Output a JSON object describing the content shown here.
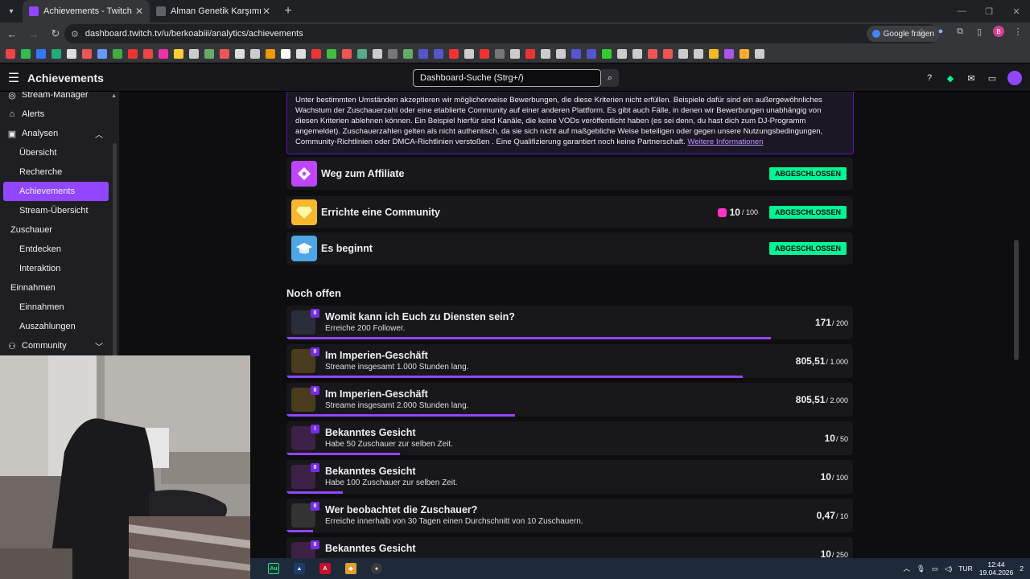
{
  "browser": {
    "tabs": [
      {
        "label": "Achievements - Twitch",
        "active": true,
        "color": "#9147ff"
      },
      {
        "label": "Alman Genetik Karşımı",
        "active": false,
        "color": "#5f6368"
      }
    ],
    "url": "dashboard.twitch.tv/u/berkoabiii/analytics/achievements",
    "google_fragen": "Google fragen",
    "profile_letter": "B"
  },
  "header": {
    "title": "Achievements",
    "search_placeholder": "Dashboard-Suche (Strg+/)"
  },
  "sidebar": {
    "items": [
      {
        "label": "Stream-Manager",
        "level": "top",
        "icon": "stream-manager-icon"
      },
      {
        "label": "Alerts",
        "level": "top",
        "icon": "alerts-icon"
      },
      {
        "label": "Analysen",
        "level": "top",
        "icon": "analytics-icon",
        "expanded": true
      },
      {
        "label": "Übersicht",
        "level": "sub"
      },
      {
        "label": "Recherche",
        "level": "sub"
      },
      {
        "label": "Achievements",
        "level": "sub",
        "active": true
      },
      {
        "label": "Stream-Übersicht",
        "level": "sub"
      },
      {
        "label": "Zuschauer",
        "level": "mid"
      },
      {
        "label": "Entdecken",
        "level": "sub"
      },
      {
        "label": "Interaktion",
        "level": "sub"
      },
      {
        "label": "Einnahmen",
        "level": "mid"
      },
      {
        "label": "Einnahmen",
        "level": "sub"
      },
      {
        "label": "Auszahlungen",
        "level": "sub"
      },
      {
        "label": "Community",
        "level": "top",
        "icon": "community-icon",
        "collapsed": true
      }
    ]
  },
  "notice": {
    "text": "Unter bestimmten Umständen akzeptieren wir möglicherweise Bewerbungen, die diese Kriterien nicht erfüllen. Beispiele dafür sind ein außergewöhnliches Wachstum der Zuschauerzahl oder eine etablierte Community auf einer anderen Plattform. Es gibt auch Fälle, in denen wir Bewerbungen unabhängig von diesen Kriterien ablehnen können. Ein Beispiel hierfür sind Kanäle, die keine VODs veröffentlicht haben (es sei denn, du hast dich zum DJ-Programm angemeldet). Zuschauerzahlen gelten als nicht authentisch, da sie sich nicht auf maßgebliche Weise beteiligen oder gegen unsere Nutzungsbedingungen, Community-Richtlinien oder DMCA-Richtlinien verstoßen . Eine Qualifizierung garantiert noch keine Partnerschaft.",
    "link": "Weitere Informationen"
  },
  "completed": [
    {
      "name": "Weg zum Affiliate",
      "status": "ABGESCHLOSSEN",
      "badge_color": "#bf45ff",
      "progress": ""
    },
    {
      "name": "Errichte eine Community",
      "status": "ABGESCHLOSSEN",
      "badge_color": "#f5b82e",
      "progress": "10",
      "progress_total": "/ 100"
    },
    {
      "name": "Es beginnt",
      "status": "ABGESCHLOSSEN",
      "badge_color": "#4fa6e6",
      "progress": ""
    }
  ],
  "open_section_title": "Noch offen",
  "open": [
    {
      "level": "II",
      "title": "Womit kann ich Euch zu Diensten sein?",
      "desc": "Erreiche 200 Follower.",
      "value": "171",
      "total": "/ 200",
      "fraction": 0.855,
      "thumb": "#2a2d3a"
    },
    {
      "level": "II",
      "title": "Im Imperien-Geschäft",
      "desc": "Streame insgesamt 1.000 Stunden lang.",
      "value": "805,51",
      "total": "/ 1.000",
      "fraction": 0.8055,
      "thumb": "#4a3c1e"
    },
    {
      "level": "II",
      "title": "Im Imperien-Geschäft",
      "desc": "Streame insgesamt 2.000 Stunden lang.",
      "value": "805,51",
      "total": "/ 2.000",
      "fraction": 0.4028,
      "thumb": "#4a3c1e"
    },
    {
      "level": "I",
      "title": "Bekanntes Gesicht",
      "desc": "Habe 50 Zuschauer zur selben Zeit.",
      "value": "10",
      "total": "/ 50",
      "fraction": 0.2,
      "thumb": "#3d2147"
    },
    {
      "level": "II",
      "title": "Bekanntes Gesicht",
      "desc": "Habe 100 Zuschauer zur selben Zeit.",
      "value": "10",
      "total": "/ 100",
      "fraction": 0.1,
      "thumb": "#3d2147"
    },
    {
      "level": "II",
      "title": "Wer beobachtet die Zuschauer?",
      "desc": "Erreiche innerhalb von 30 Tagen einen Durchschnitt von 10 Zuschauern.",
      "value": "0,47",
      "total": "/ 10",
      "fraction": 0.047,
      "thumb": "#333"
    },
    {
      "level": "II",
      "title": "Bekanntes Gesicht",
      "desc": "",
      "value": "10",
      "total": "/ 250",
      "fraction": 0.04,
      "thumb": "#3d2147"
    }
  ],
  "taskbar": {
    "lang": "TUR",
    "time": "12:44",
    "date": "19.04.2026",
    "notifications": "2"
  }
}
